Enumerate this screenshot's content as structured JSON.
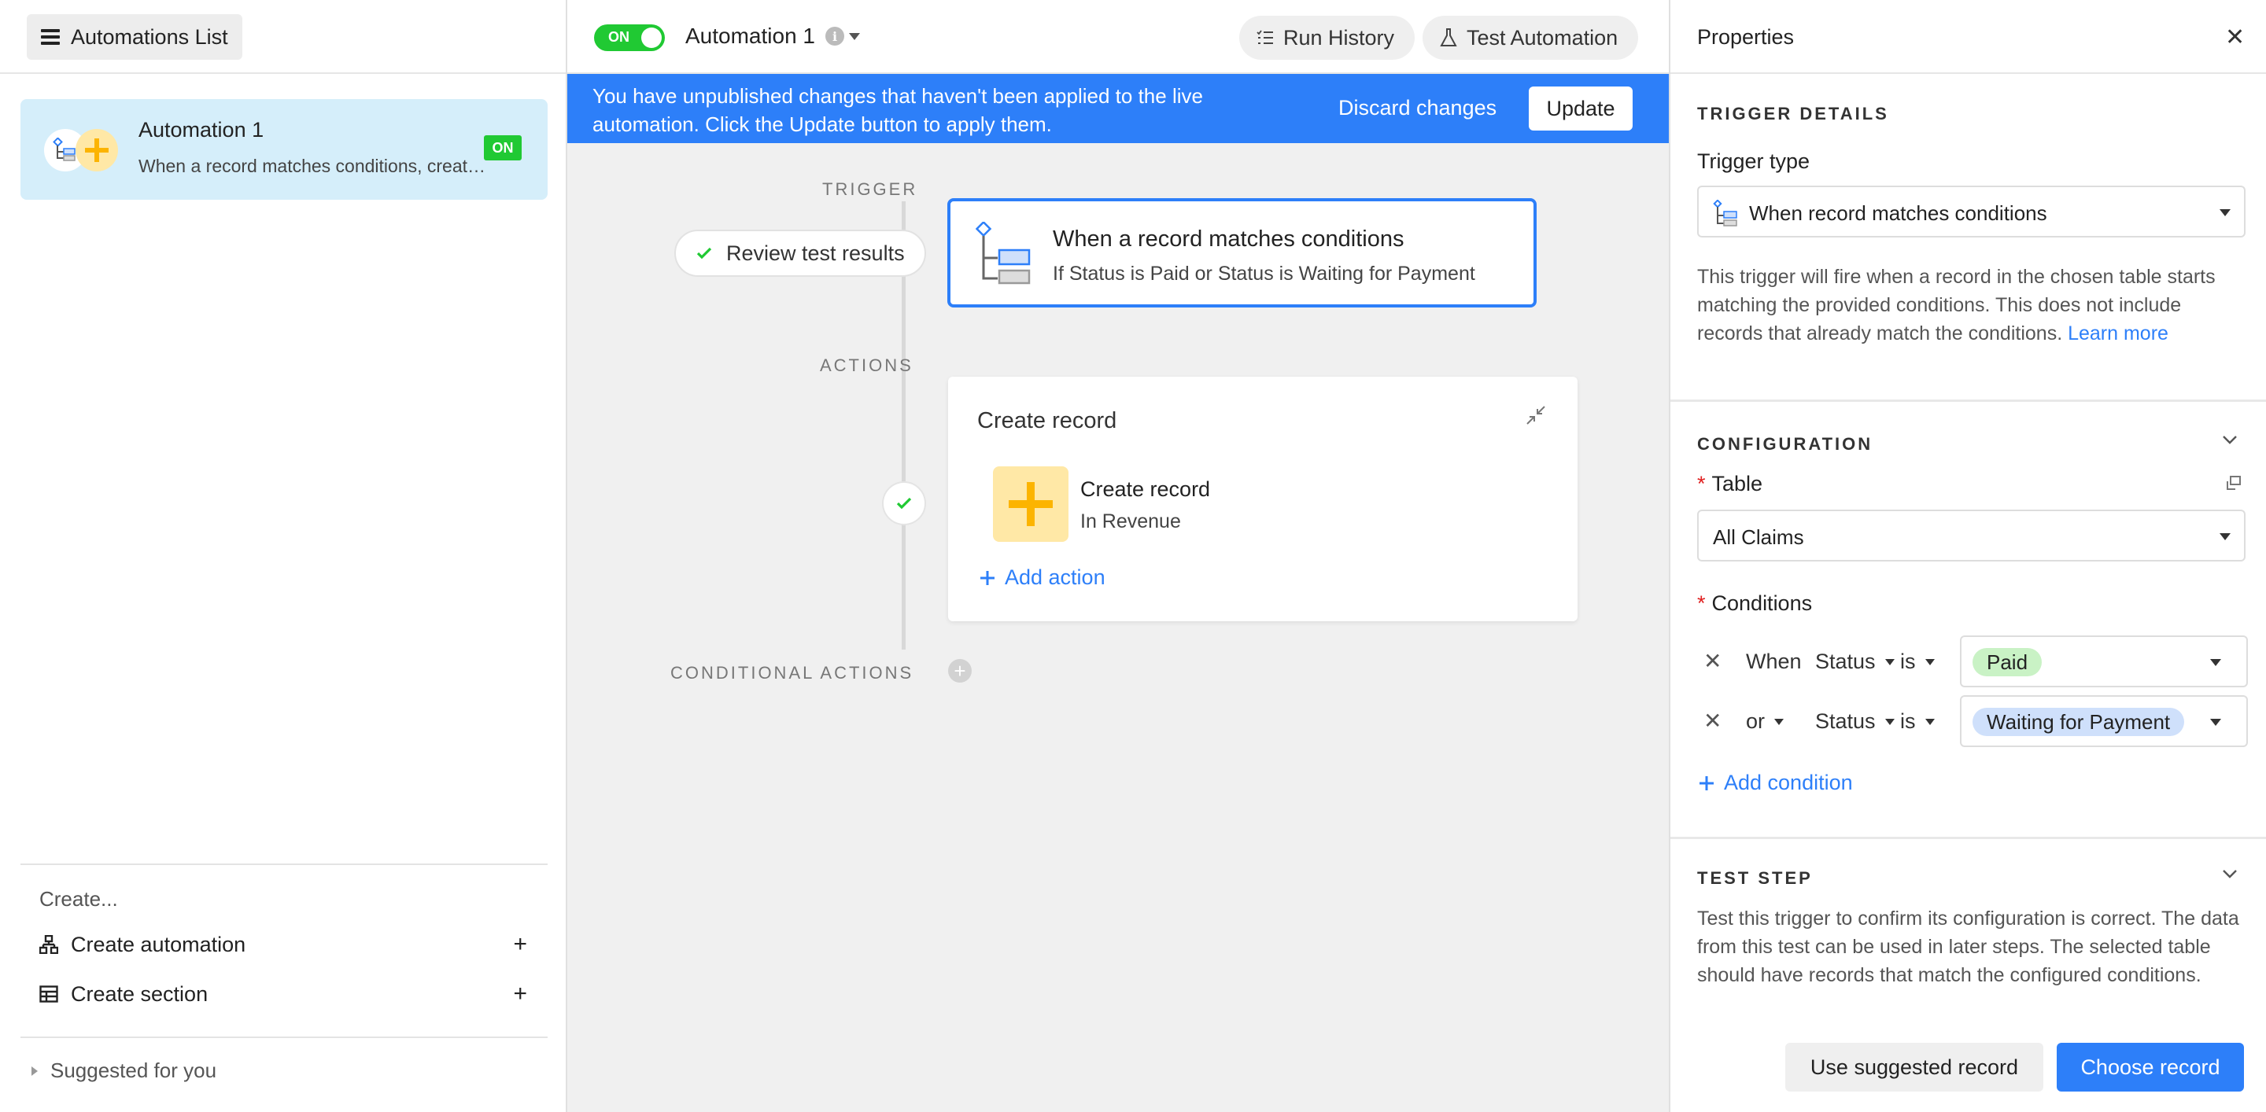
{
  "sidebar": {
    "list_button_label": "Automations List",
    "automation": {
      "title": "Automation 1",
      "description": "When a record matches conditions, create a record",
      "status_badge": "ON"
    },
    "create_label": "Create...",
    "create_automation": "Create automation",
    "create_section": "Create section",
    "suggested": "Suggested for you"
  },
  "header": {
    "toggle_label": "ON",
    "automation_name": "Automation 1",
    "run_history": "Run History",
    "test_automation": "Test Automation"
  },
  "banner": {
    "text": "You have unpublished changes that haven't been applied to the live automation. Click the Update button to apply them.",
    "discard": "Discard changes",
    "update": "Update"
  },
  "canvas": {
    "trigger_label": "TRIGGER",
    "actions_label": "ACTIONS",
    "conditional_label": "CONDITIONAL ACTIONS",
    "review_button": "Review test results",
    "trigger_card": {
      "title": "When a record matches conditions",
      "subtitle": "If Status is Paid or Status is Waiting for Payment"
    },
    "action_card": {
      "title": "Create record",
      "item_title": "Create record",
      "item_subtitle": "In Revenue",
      "add_action": "Add action"
    }
  },
  "panel": {
    "title": "Properties",
    "trigger_details_label": "TRIGGER DETAILS",
    "trigger_type_label": "Trigger type",
    "trigger_type_value": "When record matches conditions",
    "trigger_desc": "This trigger will fire when a record in the chosen table starts matching the provided conditions. This does not include records that already match the conditions.",
    "learn_more": "Learn more",
    "configuration_label": "CONFIGURATION",
    "table_label": "Table",
    "table_value": "All Claims",
    "conditions_label": "Conditions",
    "conditions": [
      {
        "connector": "When",
        "field": "Status",
        "operator": "is",
        "value": "Paid",
        "value_color": "#c9f2c5"
      },
      {
        "connector": "or",
        "field": "Status",
        "operator": "is",
        "value": "Waiting for Payment",
        "value_color": "#cfe0fb"
      }
    ],
    "add_condition": "Add condition",
    "test_step_label": "TEST STEP",
    "test_desc": "Test this trigger to confirm its configuration is correct. The data from this test can be used in later steps. The selected table should have records that match the configured conditions.",
    "use_suggested": "Use suggested record",
    "choose_record": "Choose record"
  },
  "icons": {
    "hamburger": "hamburger-icon",
    "trigger": "trigger-conditions-icon",
    "create": "plus-icon",
    "check": "check-icon",
    "collapse": "collapse-icon",
    "chevron": "chevron-down-icon",
    "close": "close-icon",
    "info": "info-icon"
  },
  "colors": {
    "accent_blue": "#2d7ff9",
    "on_green": "#20c933",
    "selected_card": "#d5eefa",
    "action_yellow": "#ffe8a6",
    "plus_orange": "#fcb400"
  }
}
